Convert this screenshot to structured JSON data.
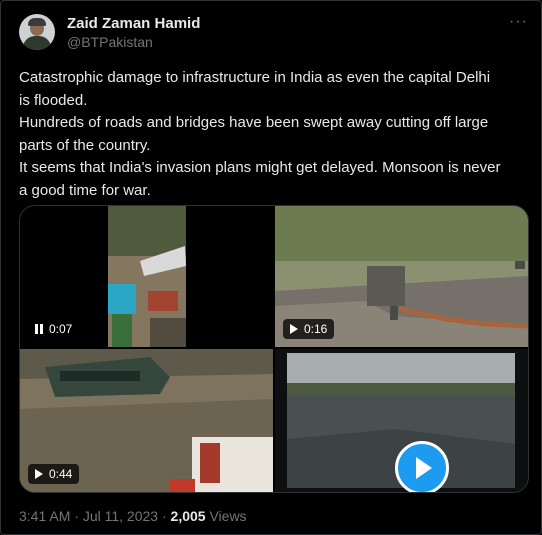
{
  "author": {
    "name": "Zaid Zaman Hamid",
    "handle": "@BTPakistan"
  },
  "more_menu": "···",
  "tweet_lines": [
    "Catastrophic damage to infrastructure in India as even the capital Delhi",
    "is flooded.",
    "Hundreds of roads and bridges have been swept away cutting off large",
    "parts of the country.",
    "It seems that India's invasion plans might get delayed. Monsoon is never",
    "a good time for war."
  ],
  "media": [
    {
      "duration": "0:07",
      "state": "paused"
    },
    {
      "duration": "0:16",
      "state": "video"
    },
    {
      "duration": "0:44",
      "state": "video"
    },
    {
      "duration": "",
      "state": "play-button"
    }
  ],
  "footer": {
    "time": "3:41 AM",
    "date": "Jul 11, 2023",
    "separator": "·",
    "views_count": "2,005",
    "views_label": "Views"
  },
  "colors": {
    "background": "#000000",
    "text": "#e7e9ea",
    "muted": "#71767b",
    "border": "#2f3336",
    "accent": "#1d9bf0"
  }
}
